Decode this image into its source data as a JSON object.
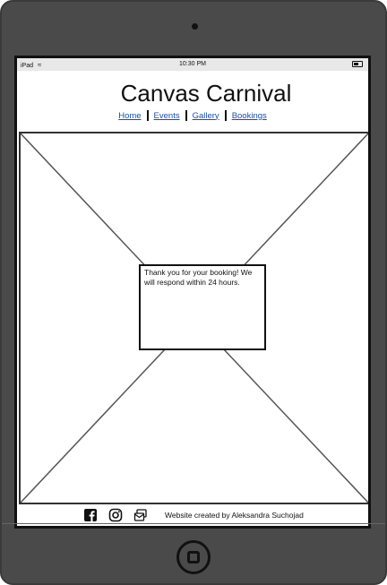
{
  "statusbar": {
    "device": "iPad",
    "time": "10:30 PM"
  },
  "header": {
    "title": "Canvas Carnival"
  },
  "nav": {
    "items": [
      {
        "label": "Home"
      },
      {
        "label": "Events"
      },
      {
        "label": "Gallery"
      },
      {
        "label": "Bookings"
      }
    ]
  },
  "confirmation": {
    "message": "Thank you for your booking! We will respond within 24 hours."
  },
  "footer": {
    "icons": [
      "facebook-icon",
      "instagram-icon",
      "mail-icon"
    ],
    "credit": "Website created by Aleksandra Suchojad"
  }
}
